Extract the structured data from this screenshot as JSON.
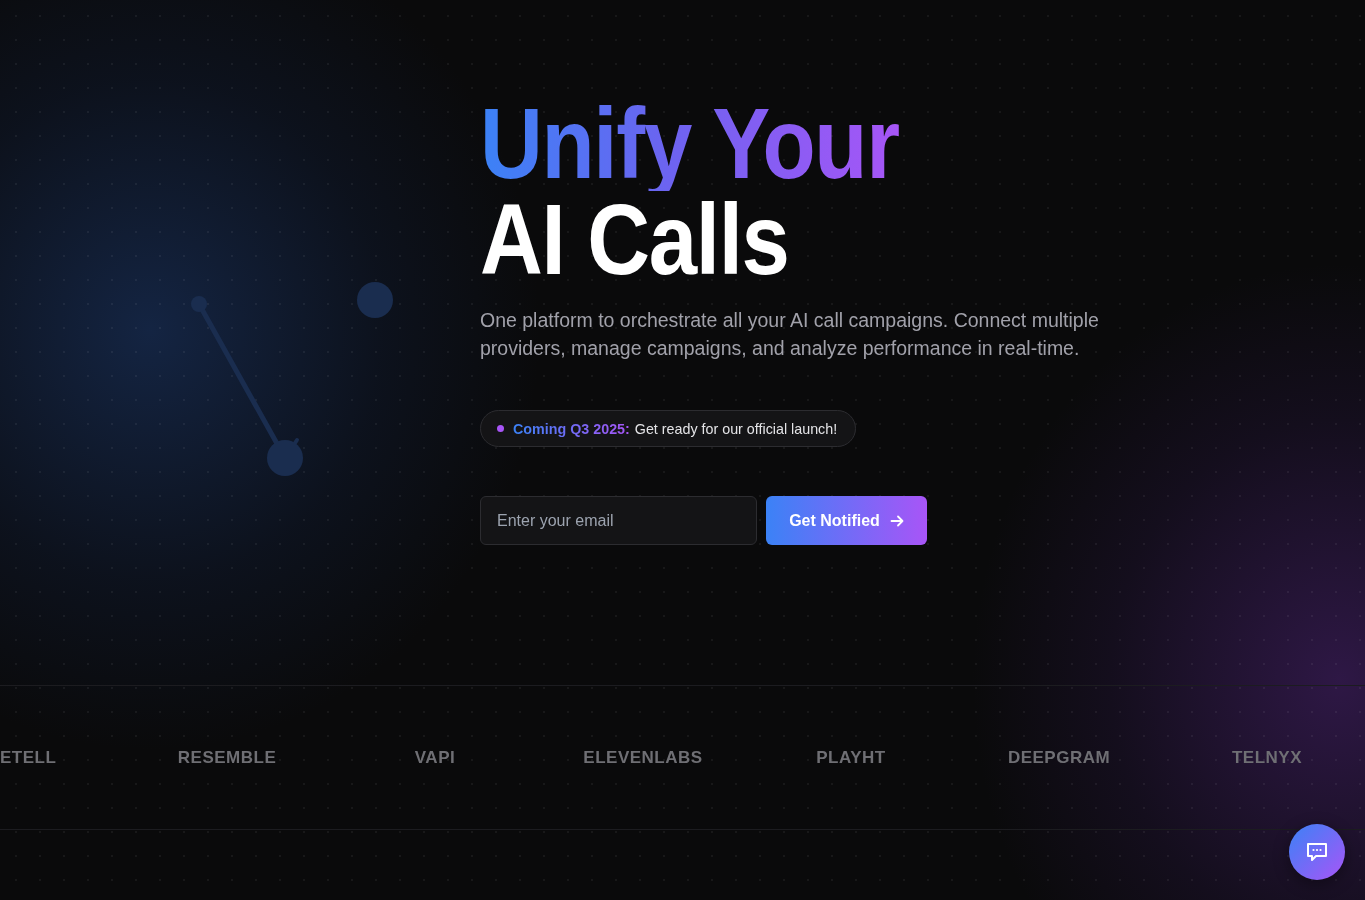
{
  "hero": {
    "title_lines": [
      {
        "text": "Unify Your",
        "kind": "gradient"
      },
      {
        "text": "AI Calls",
        "kind": "plain"
      }
    ],
    "subtitle": "One platform to orchestrate all your AI call campaigns. Connect multiple providers, manage campaigns, and analyze performance in real-time.",
    "badge": {
      "label": "Coming Q3 2025:",
      "text": "Get ready for our official launch!"
    },
    "signup": {
      "email": {
        "placeholder": "Enter your email"
      },
      "button": {
        "label": "Get Notified"
      }
    }
  },
  "providers": [
    "ETELL",
    "RESEMBLE",
    "VAPI",
    "ELEVENLABS",
    "PLAYHT",
    "DEEPGRAM",
    "TELNYX"
  ]
}
